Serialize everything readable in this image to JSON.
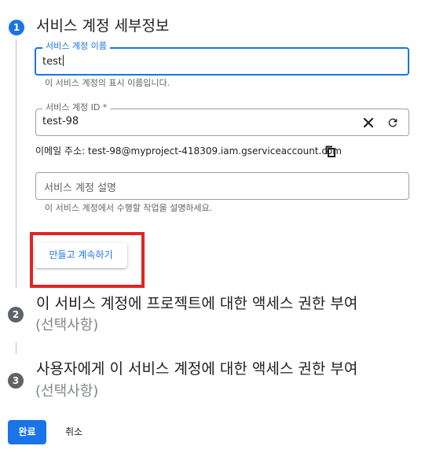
{
  "steps": [
    {
      "number": "1",
      "title": "서비스 계정 세부정보"
    },
    {
      "number": "2",
      "title": "이 서비스 계정에 프로젝트에 대한 액세스 권한 부여",
      "optional": "(선택사항)"
    },
    {
      "number": "3",
      "title": "사용자에게 이 서비스 계정에 대한 액세스 권한 부여",
      "optional": "(선택사항)"
    }
  ],
  "form": {
    "name_field": {
      "label": "서비스 계정 이름",
      "value": "test",
      "helper": "이 서비스 계정의 표시 이름입니다."
    },
    "id_field": {
      "label": "서비스 계정 ID *",
      "value": "test-98"
    },
    "email": {
      "text": "이메일 주소: test-98@myproject-418309.iam.gserviceaccount.com"
    },
    "description_field": {
      "placeholder": "서비스 계정 설명",
      "helper": "이 서비스 계정에서 수행할 작업을 설명하세요."
    },
    "create_button": "만들고 계속하기"
  },
  "footer": {
    "done_label": "완료",
    "cancel_label": "취소"
  },
  "colors": {
    "accent": "#1a73e8",
    "highlight_box": "#e02424",
    "inactive_step": "#5f6368"
  },
  "icons": {
    "clear": "close-icon",
    "regenerate": "refresh-icon",
    "copy": "copy-icon"
  }
}
